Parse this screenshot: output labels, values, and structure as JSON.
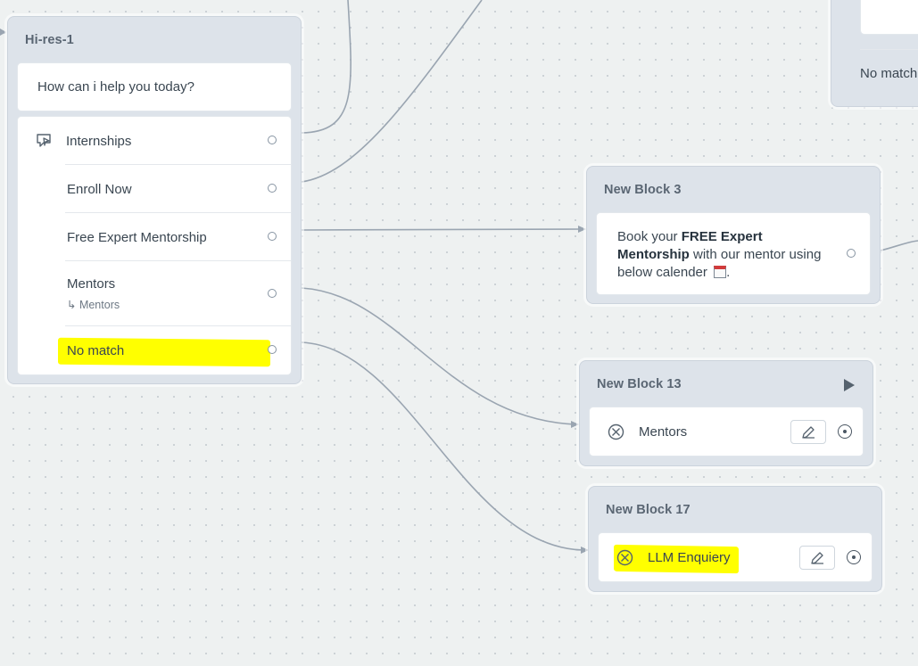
{
  "blocks": {
    "hires": {
      "title": "Hi-res-1",
      "prompt": "How can i help you today?",
      "options": [
        {
          "label": "Internships"
        },
        {
          "label": "Enroll Now"
        },
        {
          "label": "Free Expert Mentorship"
        },
        {
          "label": "Mentors",
          "sub": "↳ Mentors"
        },
        {
          "label": "No match"
        }
      ]
    },
    "block3": {
      "title": "New Block 3",
      "message_prefix": "Book your ",
      "message_bold": "FREE Expert Mentorship",
      "message_suffix": " with  our mentor using below calender",
      "message_end": "."
    },
    "block13": {
      "title": "New Block 13",
      "item": "Mentors"
    },
    "block17": {
      "title": "New Block 17",
      "item": "LLM Enquiery"
    },
    "topright": {
      "item": "No match"
    }
  },
  "colors": {
    "highlight": "#ffff00",
    "edge": "#9aa5b1",
    "block_bg": "#dde3ea"
  },
  "icons": {
    "internships_row": "message-play-icon",
    "block13_play": "play-icon",
    "action_type": "action-cross-icon",
    "edit": "pencil-icon",
    "target": "target-icon"
  }
}
